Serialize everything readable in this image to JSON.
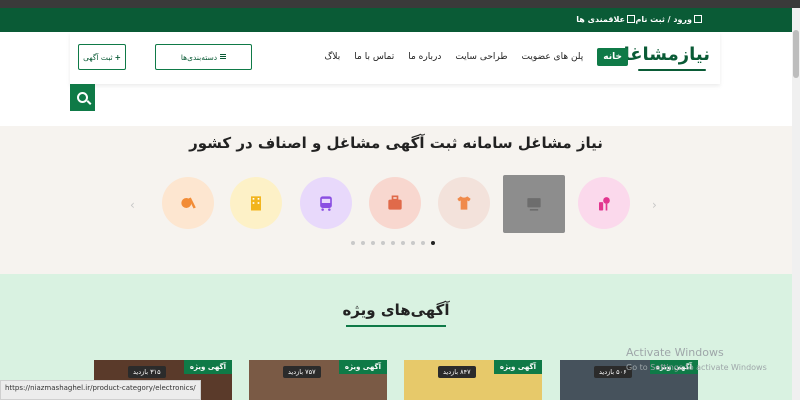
{
  "topbar": {
    "login": "ورود / ثبت نام",
    "favorites": "علاقمندی ها"
  },
  "header": {
    "logo_text": "نیازمشاغل",
    "nav": [
      "خانه",
      "پلن های عضویت",
      "طراحی سایت",
      "درباره ما",
      "تماس با ما",
      "بلاگ"
    ],
    "categories_button": "دسته‌بندی‌ها",
    "post_ad_button": "ثبت آگهی"
  },
  "hero": {
    "title": "نیاز مشاغل سامانه ثبت آگهی مشاغل و اصناف در کشور",
    "categories": [
      {
        "icon": "cosmetics-icon",
        "bg": "#fbd9ec",
        "fg": "#e2358f"
      },
      {
        "icon": "electronics-icon",
        "bg": "#8d8d8d",
        "fg": "#6d6d6d",
        "square": true
      },
      {
        "icon": "clothing-icon",
        "bg": "#f3e2db",
        "fg": "#f08a4b"
      },
      {
        "icon": "bag-icon",
        "bg": "#f8d7cf",
        "fg": "#e06a4a"
      },
      {
        "icon": "bus-icon",
        "bg": "#e8d9fb",
        "fg": "#8a4fe2"
      },
      {
        "icon": "building-icon",
        "bg": "#fdf1c7",
        "fg": "#f2b51e"
      },
      {
        "icon": "sports-icon",
        "bg": "#fde6d0",
        "fg": "#f28c36"
      }
    ],
    "dots": {
      "count": 9,
      "active": 8
    }
  },
  "featured": {
    "title": "آگهی‌های ویژه",
    "cards": [
      {
        "badge": "آگهی ویژه",
        "views": "۳۱۵ بازدید",
        "color": "#5a3a2a"
      },
      {
        "badge": "آگهی ویژه",
        "views": "۷۵۷ بازدید",
        "color": "#7a5a45"
      },
      {
        "badge": "آگهی ویژه",
        "views": "۸۴۷ بازدید",
        "color": "#e7c96a"
      },
      {
        "badge": "آگهی ویژه",
        "views": "۵۰۶ بازدید",
        "color": "#46525c"
      }
    ]
  },
  "status_url": "https://niazmashaghel.ir/product-category/electronics/",
  "watermark": {
    "line1": "Activate Windows",
    "line2": "Go to Settings to activate Windows"
  }
}
